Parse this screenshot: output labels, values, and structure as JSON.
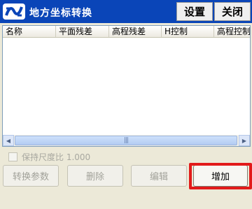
{
  "window": {
    "title": "地方坐标转换",
    "settings_label": "设置",
    "close_label": "关闭"
  },
  "table": {
    "columns": [
      "名称",
      "平面残差",
      "高程残差",
      "H控制",
      "高程控制"
    ],
    "rows": []
  },
  "scale_checkbox": {
    "label": "保持尺度比 1.000",
    "checked": false,
    "enabled": false
  },
  "buttons": {
    "params_label": "转换参数",
    "delete_label": "删除",
    "edit_label": "编辑",
    "add_label": "增加"
  },
  "colors": {
    "title_bar": "#0a45b8",
    "highlight": "#e21a1a"
  },
  "icons": {
    "logo": "app-logo-icon",
    "scroll_left": "scroll-left-arrow-icon",
    "scroll_right": "scroll-right-arrow-icon"
  }
}
